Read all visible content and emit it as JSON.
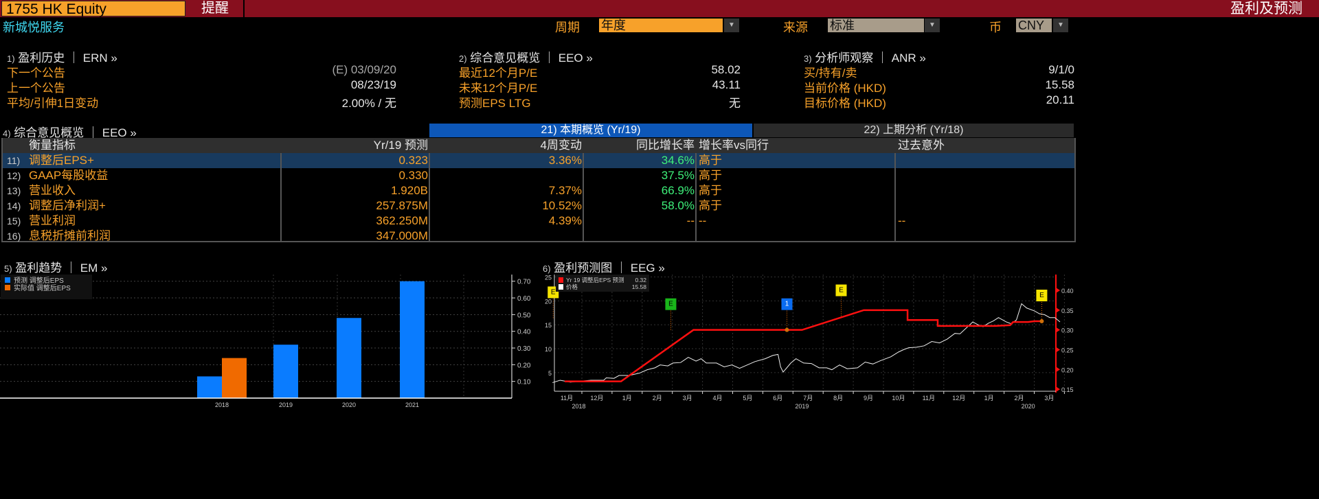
{
  "header": {
    "ticker": "1755 HK Equity",
    "alert_label": "提醒",
    "function_title": "盈利及预测",
    "company_name": "新城悦服务"
  },
  "controls": {
    "period_label": "周期",
    "period_value": "年度",
    "source_label": "来源",
    "source_value": "标准",
    "currency_label": "币",
    "currency_value": "CNY"
  },
  "colors": {
    "orange": "#f7a12a",
    "header_red": "#870f1e",
    "blue": "#0a7cff",
    "actual_orange": "#f06a00",
    "eps_red": "#ff1010"
  },
  "panels": {
    "ern": {
      "num": "1)",
      "title": "盈利历史 ｜ ERN »",
      "rows": [
        {
          "label": "下一个公告",
          "value": "(E) 03/09/20"
        },
        {
          "label": "上一个公告",
          "value": "08/23/19"
        },
        {
          "label": "平均/引伸1日变动",
          "value": "2.00% / 无"
        }
      ]
    },
    "eeo": {
      "num": "2)",
      "title": "综合意见概览 ｜ EEO »",
      "rows": [
        {
          "label": "最近12个月P/E",
          "value": "58.02"
        },
        {
          "label": "未来12个月P/E",
          "value": "43.11"
        },
        {
          "label": "预测EPS LTG",
          "value": "无"
        }
      ]
    },
    "anr": {
      "num": "3)",
      "title": "分析师观察 ｜ ANR »",
      "rows": [
        {
          "label": "买/持有/卖",
          "value": "9/1/0"
        },
        {
          "label": "当前价格 (HKD)",
          "value": "15.58"
        },
        {
          "label": "目标价格 (HKD)",
          "value": "20.11"
        }
      ]
    }
  },
  "table_section": {
    "num": "4)",
    "title": "综合意见概览 ｜ EEO »",
    "tabs": [
      {
        "label": "21) 本期概览 (Yr/19)",
        "active": true
      },
      {
        "label": "22) 上期分析 (Yr/18)",
        "active": false
      }
    ],
    "columns": [
      "衡量指标",
      "Yr/19 预测",
      "4周变动",
      "同比增长率",
      "增长率vs同行",
      "过去意外"
    ],
    "rows": [
      {
        "num": "11)",
        "name": "调整后EPS+",
        "forecast": "0.323",
        "chg4w": "3.36%",
        "yoy": "34.6%",
        "vs_peers": "高于",
        "surprise": ""
      },
      {
        "num": "12)",
        "name": "GAAP每股收益",
        "forecast": "0.330",
        "chg4w": "",
        "yoy": "37.5%",
        "vs_peers": "高于",
        "surprise": ""
      },
      {
        "num": "13)",
        "name": "营业收入",
        "forecast": "1.920B",
        "chg4w": "7.37%",
        "yoy": "66.9%",
        "vs_peers": "高于",
        "surprise": ""
      },
      {
        "num": "14)",
        "name": "调整后净利润+",
        "forecast": "257.875M",
        "chg4w": "10.52%",
        "yoy": "58.0%",
        "vs_peers": "高于",
        "surprise": ""
      },
      {
        "num": "15)",
        "name": "营业利润",
        "forecast": "362.250M",
        "chg4w": "4.39%",
        "yoy": "--",
        "vs_peers": "--",
        "surprise": "--"
      },
      {
        "num": "16)",
        "name": "息税折摊前利润",
        "forecast": "347.000M",
        "chg4w": "",
        "yoy": "",
        "vs_peers": "",
        "surprise": ""
      }
    ]
  },
  "chart_data": [
    {
      "type": "bar",
      "panel_num": "5)",
      "title": "盈利趋势 ｜ EM »",
      "categories": [
        "2018",
        "2019",
        "2020",
        "2021"
      ],
      "series": [
        {
          "name": "预测 调整后EPS",
          "values": [
            0.13,
            0.32,
            0.48,
            0.7
          ]
        },
        {
          "name": "实际值 调整后EPS",
          "values": [
            0.24,
            null,
            null,
            null
          ]
        }
      ],
      "yticks": [
        "0.10",
        "0.20",
        "0.30",
        "0.40",
        "0.50",
        "0.60",
        "0.70"
      ],
      "ylim": [
        0,
        0.74
      ],
      "legend": "top-left",
      "grid": true
    },
    {
      "type": "line",
      "panel_num": "6)",
      "title": "盈利预测图 ｜ EEG »",
      "x_months": [
        "11月",
        "12月",
        "1月",
        "2月",
        "3月",
        "4月",
        "5月",
        "6月",
        "7月",
        "8月",
        "9月",
        "10月",
        "11月",
        "12月",
        "1月",
        "2月",
        "3月"
      ],
      "years": [
        {
          "label": "2018",
          "at": 0.4
        },
        {
          "label": "2019",
          "at": 7.8
        },
        {
          "label": "2020",
          "at": 15.3
        }
      ],
      "left_yticks": [
        "5",
        "10",
        "15",
        "20",
        "25"
      ],
      "left_ylim": [
        1.1,
        25.5
      ],
      "right_yticks": [
        "0.15",
        "0.20",
        "0.25",
        "0.30",
        "0.35",
        "0.40"
      ],
      "right_ylim": [
        0.145,
        0.44
      ],
      "legend": [
        {
          "label": "Yr 19 调整后EPS 预测",
          "value": "0.32"
        },
        {
          "label": "价格",
          "value": "15.58"
        }
      ],
      "eps_series": [
        [
          -0.07,
          0.17
        ],
        [
          1.8,
          0.17
        ],
        [
          4.2,
          0.3
        ],
        [
          7.8,
          0.3
        ],
        [
          9.85,
          0.35
        ],
        [
          11.3,
          0.35
        ],
        [
          11.3,
          0.325
        ],
        [
          12.3,
          0.325
        ],
        [
          12.3,
          0.31
        ],
        [
          14.2,
          0.31
        ],
        [
          14.7,
          0.312
        ],
        [
          14.8,
          0.32
        ],
        [
          15.3,
          0.32
        ],
        [
          15.5,
          0.322
        ],
        [
          15.8,
          0.322
        ]
      ],
      "price_series": [
        [
          -0.5,
          2.9
        ],
        [
          -0.2,
          3.4
        ],
        [
          0.2,
          3.0
        ],
        [
          0.6,
          3.2
        ],
        [
          1.0,
          3.4
        ],
        [
          1.5,
          3.4
        ],
        [
          1.6,
          3.9
        ],
        [
          1.9,
          3.8
        ],
        [
          2.1,
          4.4
        ],
        [
          2.5,
          4.4
        ],
        [
          2.9,
          4.9
        ],
        [
          3.2,
          5.6
        ],
        [
          3.5,
          6.0
        ],
        [
          3.7,
          6.6
        ],
        [
          4.0,
          6.4
        ],
        [
          4.2,
          7.0
        ],
        [
          4.5,
          7.1
        ],
        [
          4.8,
          8.2
        ],
        [
          5.1,
          7.4
        ],
        [
          5.3,
          7.9
        ],
        [
          5.5,
          7.0
        ],
        [
          5.9,
          7.0
        ],
        [
          6.2,
          6.2
        ],
        [
          6.5,
          6.6
        ],
        [
          6.8,
          5.9
        ],
        [
          7.1,
          6.6
        ],
        [
          7.4,
          7.3
        ],
        [
          7.8,
          7.9
        ],
        [
          8.1,
          8.6
        ],
        [
          8.3,
          8.8
        ],
        [
          8.4,
          6.2
        ],
        [
          8.5,
          5.1
        ],
        [
          8.8,
          7.0
        ],
        [
          9.0,
          7.9
        ],
        [
          9.3,
          7.0
        ],
        [
          9.6,
          6.9
        ],
        [
          9.9,
          6.0
        ],
        [
          10.2,
          6.0
        ],
        [
          10.4,
          5.6
        ],
        [
          10.7,
          6.6
        ],
        [
          11.0,
          5.8
        ],
        [
          11.4,
          6.0
        ],
        [
          11.7,
          7.2
        ],
        [
          12.0,
          6.8
        ],
        [
          12.3,
          7.5
        ],
        [
          12.7,
          8.3
        ],
        [
          13.0,
          9.3
        ],
        [
          13.2,
          9.8
        ],
        [
          13.4,
          10.2
        ],
        [
          13.7,
          10.3
        ],
        [
          14.0,
          10.6
        ],
        [
          14.3,
          11.5
        ],
        [
          14.6,
          11.2
        ],
        [
          14.9,
          12.0
        ],
        [
          15.2,
          13.2
        ],
        [
          15.4,
          13.1
        ],
        [
          15.6,
          14.1
        ],
        [
          15.9,
          15.6
        ],
        [
          16.1,
          15.0
        ],
        [
          16.3,
          14.6
        ],
        [
          16.5,
          15.3
        ],
        [
          16.7,
          15.8
        ],
        [
          16.9,
          16.5
        ],
        [
          17.2,
          15.6
        ],
        [
          17.4,
          15.2
        ],
        [
          17.6,
          16.0
        ],
        [
          17.8,
          19.4
        ],
        [
          18.0,
          18.5
        ],
        [
          18.3,
          17.9
        ],
        [
          18.5,
          17.3
        ],
        [
          18.7,
          17.1
        ],
        [
          18.9,
          16.5
        ],
        [
          19.1,
          16.5
        ],
        [
          19.3,
          15.6
        ]
      ],
      "markers": [
        {
          "label": "E",
          "color": "#f5e400",
          "month": -0.45,
          "value": 0.33
        },
        {
          "label": "E",
          "color": "#19b61a",
          "month": 3.45,
          "value": 0.3
        },
        {
          "label": "1",
          "color": "#0a6cf0",
          "month": 7.3,
          "value": 0.3
        },
        {
          "label": "E",
          "color": "#f5e400",
          "month": 9.1,
          "value": 0.335
        },
        {
          "label": "E",
          "color": "#f5e400",
          "month": 15.75,
          "value": 0.322
        }
      ]
    }
  ]
}
